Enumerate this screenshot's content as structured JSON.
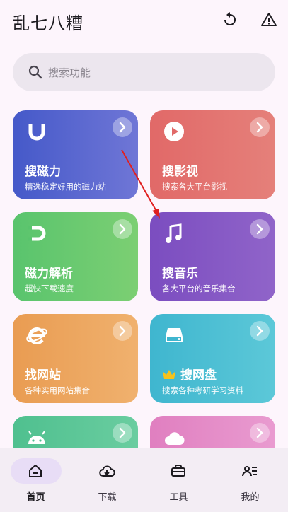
{
  "app": {
    "title": "乱七八糟"
  },
  "header": {
    "refresh_icon": "refresh-icon",
    "warning_icon": "warning-triangle-icon"
  },
  "search": {
    "placeholder": "搜索功能"
  },
  "cards": [
    {
      "title": "搜磁力",
      "subtitle": "精选稳定好用的磁力站",
      "icon": "magnet-u-icon",
      "color_from": "#4559c9",
      "color_to": "#6f76d6"
    },
    {
      "title": "搜影视",
      "subtitle": "搜索各大平台影视",
      "icon": "play-circle-icon",
      "color_from": "#e16968",
      "color_to": "#e5807a"
    },
    {
      "title": "磁力解析",
      "subtitle": "超快下载速度",
      "icon": "magnet-icon",
      "color_from": "#59c46d",
      "color_to": "#7ccf73"
    },
    {
      "title": "搜音乐",
      "subtitle": "各大平台的音乐集合",
      "icon": "music-note-icon",
      "color_from": "#7b4dc0",
      "color_to": "#9064c9"
    },
    {
      "title": "找网站",
      "subtitle": "各种实用网站集合",
      "icon": "ie-browser-icon",
      "color_from": "#e99c52",
      "color_to": "#f0b16e"
    },
    {
      "title": "搜网盘",
      "subtitle": "搜索各种考研学习资料",
      "icon": "drive-icon",
      "color_from": "#3fb6cf",
      "color_to": "#5cc8d8"
    },
    {
      "title": "",
      "subtitle": "",
      "icon": "android-icon",
      "color_from": "#4fc08f",
      "color_to": "#6acda0"
    },
    {
      "title": "",
      "subtitle": "",
      "icon": "cloud-icon",
      "color_from": "#e07fc0",
      "color_to": "#e99bd0"
    }
  ],
  "bottom_nav": [
    {
      "label": "首页",
      "icon": "home-icon",
      "active": true
    },
    {
      "label": "下载",
      "icon": "cloud-download-icon",
      "active": false
    },
    {
      "label": "工具",
      "icon": "toolbox-icon",
      "active": false
    },
    {
      "label": "我的",
      "icon": "profile-list-icon",
      "active": false
    }
  ]
}
